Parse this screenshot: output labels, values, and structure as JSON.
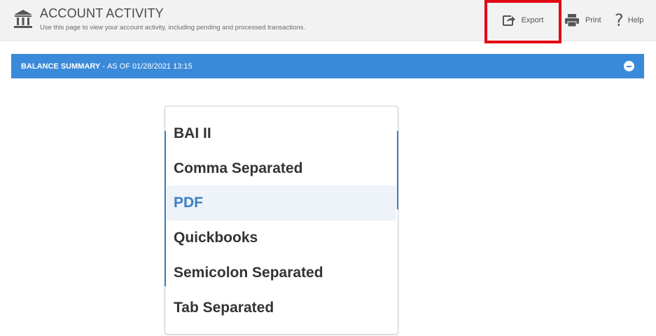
{
  "header": {
    "title": "ACCOUNT ACTIVITY",
    "subtitle": "Use this page to view your account activity, including pending and processed transactions.",
    "icon": "bank-icon"
  },
  "toolbar": {
    "export_label": "Export",
    "print_label": "Print",
    "help_label": "Help",
    "help_glyph": "?",
    "highlight_color": "#e30613"
  },
  "balance_summary": {
    "label": "BALANCE SUMMARY",
    "separator": "-",
    "as_of": "AS OF 01/28/2021 13:15",
    "bar_color": "#3b8ad9"
  },
  "export_menu": {
    "options": [
      {
        "label": "BAI II"
      },
      {
        "label": "Comma Separated"
      },
      {
        "label": "PDF"
      },
      {
        "label": "Quickbooks"
      },
      {
        "label": "Semicolon Separated"
      },
      {
        "label": "Tab Separated"
      }
    ],
    "selected_index": 2,
    "selected_color": "#3b7fc4"
  }
}
